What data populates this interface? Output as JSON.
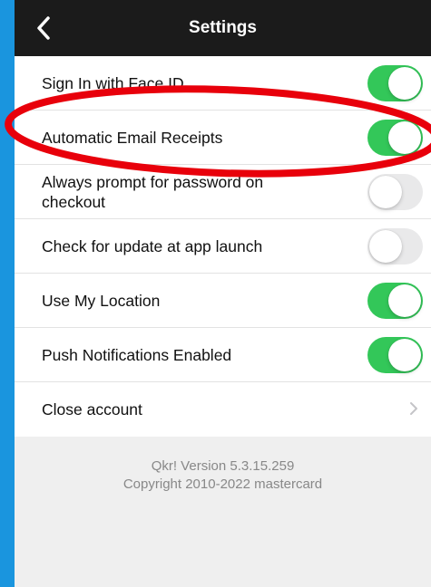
{
  "header": {
    "title": "Settings",
    "back_icon": "chevron-left-icon"
  },
  "settings": {
    "items": [
      {
        "label": "Sign In with Face ID",
        "type": "toggle",
        "on": true
      },
      {
        "label": "Automatic Email Receipts",
        "type": "toggle",
        "on": true
      },
      {
        "label": "Always prompt for password on checkout",
        "type": "toggle",
        "on": false
      },
      {
        "label": "Check for update at app launch",
        "type": "toggle",
        "on": false
      },
      {
        "label": "Use My Location",
        "type": "toggle",
        "on": true
      },
      {
        "label": "Push Notifications Enabled",
        "type": "toggle",
        "on": true
      },
      {
        "label": "Close account",
        "type": "link",
        "icon": "chevron-right-icon"
      }
    ]
  },
  "footer": {
    "version": "Qkr! Version 5.3.15.259",
    "copyright": "Copyright 2010-2022 mastercard"
  },
  "colors": {
    "page_background": "#1a95de",
    "toggle_on": "#33c759",
    "toggle_off": "#e9e9ea",
    "annotation": "#e8000b"
  }
}
